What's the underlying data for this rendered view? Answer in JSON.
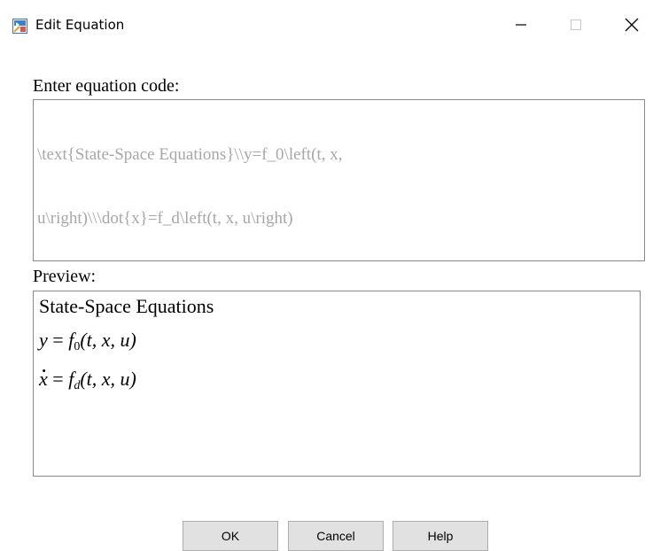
{
  "window": {
    "title": "Edit Equation",
    "controls": {
      "minimize_icon": "minimize-icon",
      "maximize_icon": "maximize-icon",
      "close_icon": "close-icon"
    }
  },
  "editor": {
    "label": "Enter equation code:",
    "code_line1": "\\text{State-Space Equations}\\\\y=f_0\\left(t, x,",
    "code_line2": "u\\right)\\\\\\dot{x}=f_d\\left(t, x, u\\right)"
  },
  "preview": {
    "label": "Preview:",
    "title": "State-Space Equations",
    "eq1": {
      "lhs": "y",
      "eq": " = ",
      "f": "f",
      "sub": "0",
      "args": "(t, x, u)"
    },
    "eq2": {
      "lhs": "x",
      "eq": " = ",
      "f": "f",
      "sub": "d",
      "args": "(t, x, u)"
    }
  },
  "buttons": {
    "ok": "OK",
    "cancel": "Cancel",
    "help": "Help"
  },
  "colors": {
    "code_text": "#a7a7a7",
    "button_bg": "#e1e1e1",
    "border": "#8a8a8a"
  }
}
